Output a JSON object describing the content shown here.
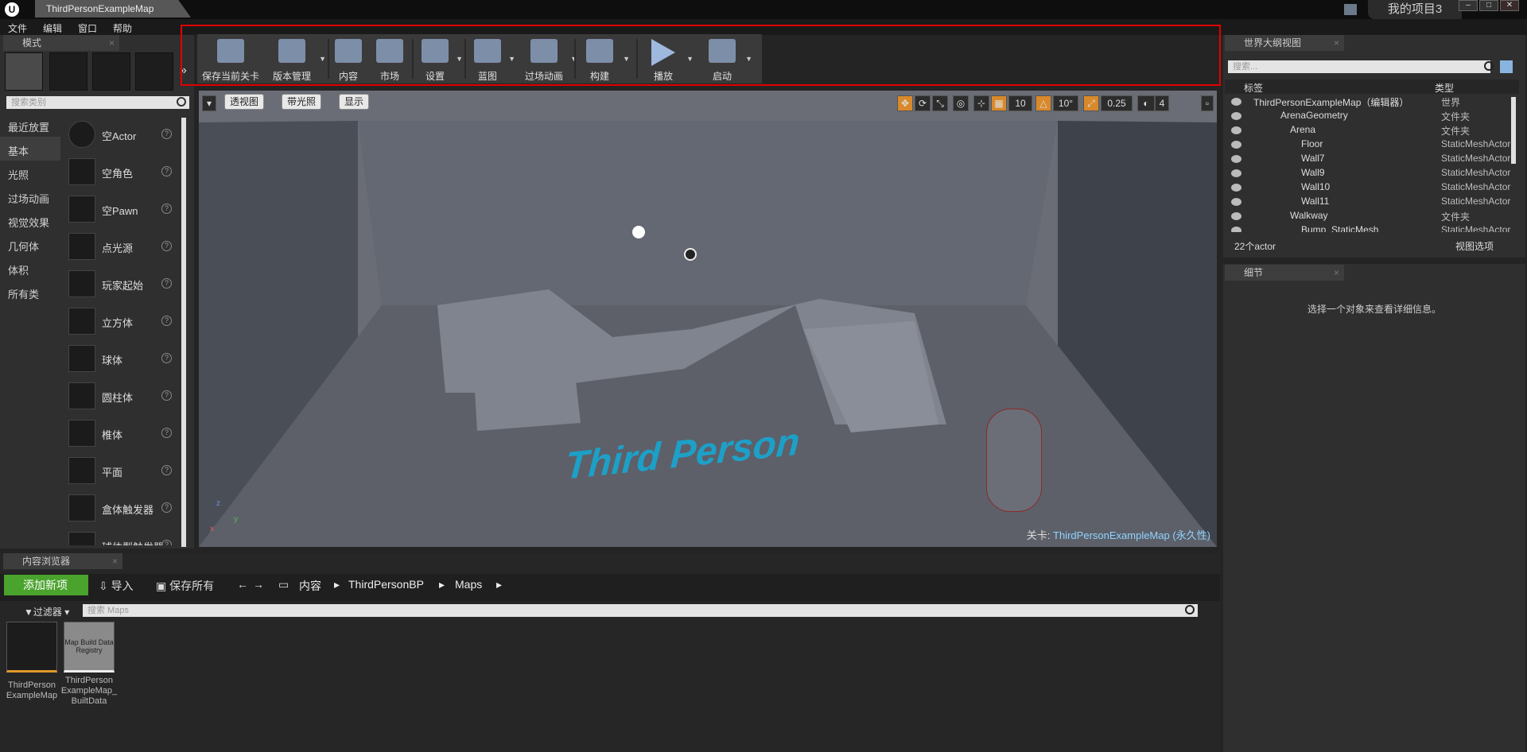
{
  "window": {
    "map_tab": "ThirdPersonExampleMap",
    "project_name": "我的项目3",
    "buttons": [
      "–",
      "□",
      "✕"
    ]
  },
  "menu": [
    "文件",
    "编辑",
    "窗口",
    "帮助"
  ],
  "modes": {
    "tab_label": "模式",
    "search_placeholder": "搜索类别",
    "categories": [
      "最近放置",
      "基本",
      "光照",
      "过场动画",
      "视觉效果",
      "几何体",
      "体积",
      "所有类"
    ],
    "selected_category": "基本",
    "items": [
      "空Actor",
      "空角色",
      "空Pawn",
      "点光源",
      "玩家起始",
      "立方体",
      "球体",
      "圆柱体",
      "椎体",
      "平面",
      "盒体触发器",
      "球体型触发器"
    ]
  },
  "toolbar": {
    "buttons": [
      {
        "label": "保存当前关卡",
        "icon": "save-icon"
      },
      {
        "label": "版本管理",
        "icon": "source-control-icon"
      },
      {
        "label": "内容",
        "icon": "content-icon"
      },
      {
        "label": "市场",
        "icon": "marketplace-icon"
      },
      {
        "label": "设置",
        "icon": "settings-icon"
      },
      {
        "label": "蓝图",
        "icon": "blueprint-icon"
      },
      {
        "label": "过场动画",
        "icon": "cinematics-icon"
      },
      {
        "label": "构建",
        "icon": "build-icon"
      },
      {
        "label": "播放",
        "icon": "play-icon"
      },
      {
        "label": "启动",
        "icon": "launch-icon"
      }
    ],
    "highlight_color": "#e00000"
  },
  "viewport": {
    "perspective": "透视图",
    "lit": "带光照",
    "show": "显示",
    "grid_snap": "10",
    "rotation_snap": "10°",
    "scale_snap": "0.25",
    "camera_speed": "4",
    "level_label": "关卡:",
    "level_name": "ThirdPersonExampleMap (永久性)",
    "floor_text": "Third Person",
    "axis_x": "x",
    "axis_y": "y",
    "axis_z": "z"
  },
  "outliner": {
    "tab_label": "世界大纲视图",
    "search_placeholder": "搜索...",
    "col_label": "标签",
    "col_type": "类型",
    "rows": [
      {
        "name": "ThirdPersonExampleMap（编辑器）",
        "type": "世界"
      },
      {
        "name": "ArenaGeometry",
        "type": "文件夹"
      },
      {
        "name": "Arena",
        "type": "文件夹"
      },
      {
        "name": "Floor",
        "type": "StaticMeshActor"
      },
      {
        "name": "Wall7",
        "type": "StaticMeshActor"
      },
      {
        "name": "Wall9",
        "type": "StaticMeshActor"
      },
      {
        "name": "Wall10",
        "type": "StaticMeshActor"
      },
      {
        "name": "Wall11",
        "type": "StaticMeshActor"
      },
      {
        "name": "Walkway",
        "type": "文件夹"
      },
      {
        "name": "Bump_StaticMesh",
        "type": "StaticMeshActor"
      }
    ],
    "actor_count": "22个actor",
    "view_options": "视图选项"
  },
  "details": {
    "tab_label": "细节",
    "empty_text": "选择一个对象来查看详细信息。"
  },
  "content_browser": {
    "tab_label": "内容浏览器",
    "add_new": "添加新项",
    "import": "导入",
    "save_all": "保存所有",
    "breadcrumb": [
      "内容",
      "ThirdPersonBP",
      "Maps"
    ],
    "filters": "过滤器",
    "search_placeholder": "搜索 Maps",
    "assets": [
      {
        "name": "ThirdPerson ExampleMap"
      },
      {
        "name": "ThirdPerson ExampleMap_ BuiltData",
        "thumb_text": "Map Build Data Registry"
      }
    ]
  }
}
